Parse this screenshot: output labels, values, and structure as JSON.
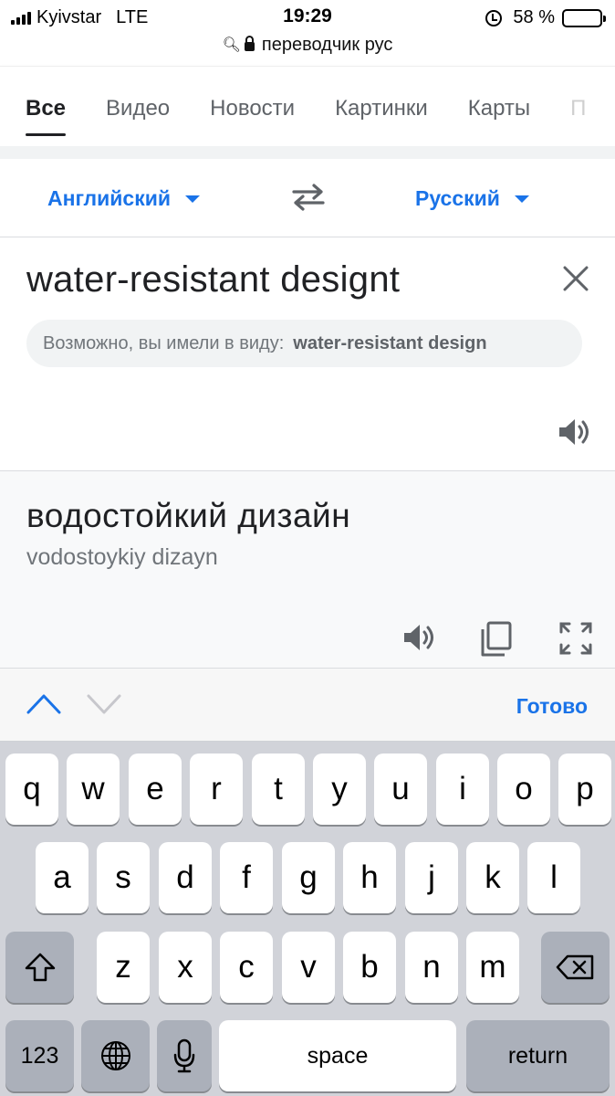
{
  "status": {
    "carrier": "Kyivstar",
    "network": "LTE",
    "time": "19:29",
    "battery": "58 %",
    "battery_level": 0.58
  },
  "urlbar": {
    "text": "переводчик рус"
  },
  "tabs": [
    {
      "label": "Все"
    },
    {
      "label": "Видео"
    },
    {
      "label": "Новости"
    },
    {
      "label": "Картинки"
    },
    {
      "label": "Карты"
    },
    {
      "label": "П"
    }
  ],
  "translator": {
    "source_lang": "Английский",
    "target_lang": "Русский",
    "source_text": "water-resistant designt",
    "did_you_mean_prefix": "Возможно, вы имели в виду:",
    "did_you_mean_suggestion": "water-resistant design",
    "result_text": "водостойкий дизайн",
    "transliteration": "vodostoykiy dizayn"
  },
  "accessory": {
    "done_label": "Готово"
  },
  "keyboard": {
    "row1": [
      "q",
      "w",
      "e",
      "r",
      "t",
      "y",
      "u",
      "i",
      "o",
      "p"
    ],
    "row2": [
      "a",
      "s",
      "d",
      "f",
      "g",
      "h",
      "j",
      "k",
      "l"
    ],
    "row3": [
      "z",
      "x",
      "c",
      "v",
      "b",
      "n",
      "m"
    ],
    "numbers_label": "123",
    "space_label": "space",
    "return_label": "return"
  },
  "colors": {
    "accent": "#1a73e8",
    "keyboard_bg": "#d1d3d9"
  }
}
